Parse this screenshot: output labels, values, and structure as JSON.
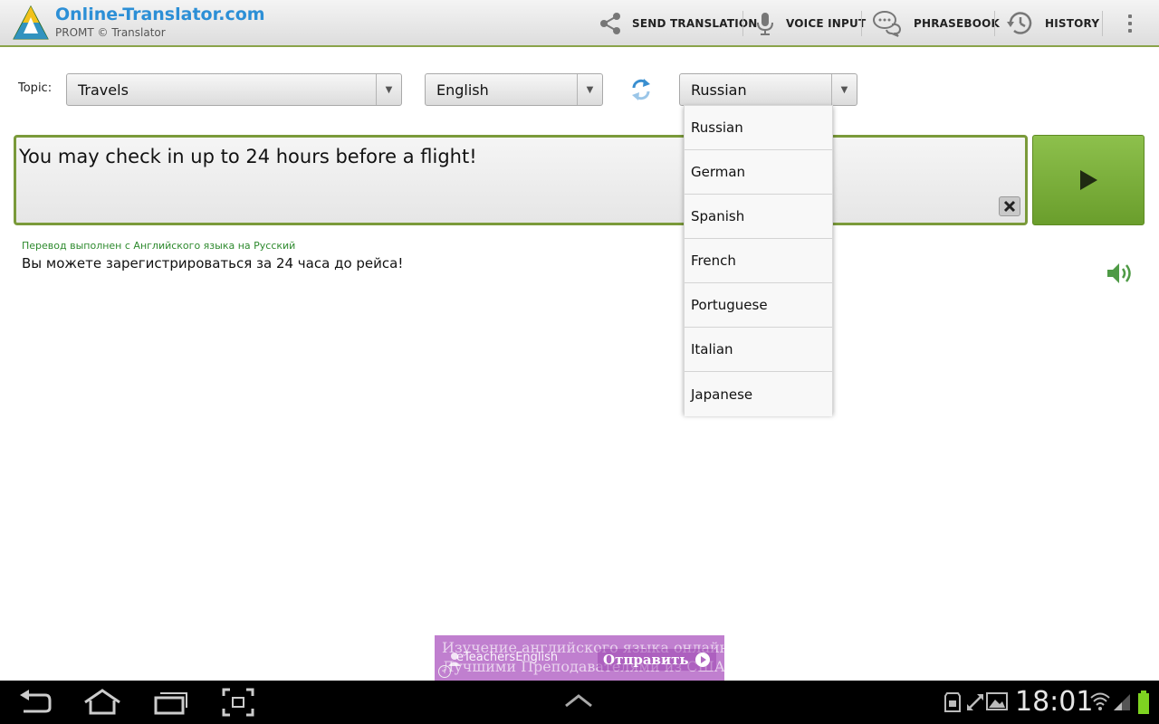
{
  "app": {
    "title": "Online-Translator.com",
    "subtitle": "PROMT © Translator"
  },
  "actions": [
    {
      "label": "SEND TRANSLATION",
      "icon": "share-icon"
    },
    {
      "label": "VOICE INPUT",
      "icon": "microphone-icon"
    },
    {
      "label": "PHRASEBOOK",
      "icon": "speech-bubbles-icon"
    },
    {
      "label": "HISTORY",
      "icon": "history-clock-icon"
    }
  ],
  "controls": {
    "topic_label": "Topic:",
    "topic_value": "Travels",
    "source_language": "English",
    "target_language": "Russian"
  },
  "input": {
    "text": "You may check in up to 24 hours before a flight!"
  },
  "result": {
    "note": "Перевод выполнен с Английского языка на Русский",
    "text": "Вы можете зарегистрироваться за 24 часа до рейса!"
  },
  "dropdown": {
    "options": [
      "Russian",
      "German",
      "Spanish",
      "French",
      "Portuguese",
      "Italian",
      "Japanese"
    ]
  },
  "ad": {
    "line1": "Изучение английского языка онлайн",
    "line2": "Лучшими Преподавателями из США",
    "brand": "eTeachersEnglish",
    "cta": "Отправить"
  },
  "statusbar": {
    "time": "18:01"
  },
  "colors": {
    "accent_green": "#7a9a3a",
    "brand_blue": "#2c8fd6",
    "result_green": "#2e8a2e",
    "ad_purple": "#c07fcf"
  }
}
